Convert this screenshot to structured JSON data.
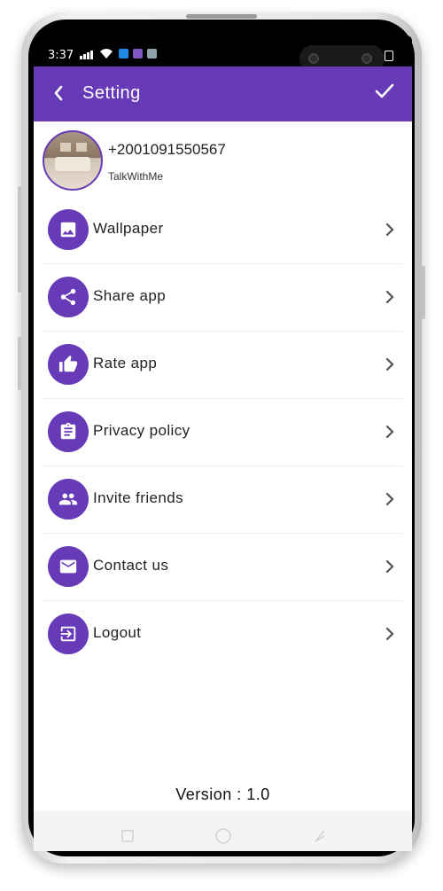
{
  "status_bar": {
    "time": "3:37"
  },
  "app_bar": {
    "title": "Setting",
    "back_icon": "back-arrow-icon",
    "confirm_icon": "check-icon"
  },
  "profile": {
    "phone": "+2001091550567",
    "app_name": "TalkWithMe"
  },
  "menu": {
    "items": [
      {
        "label": "Wallpaper",
        "icon": "image-icon"
      },
      {
        "label": "Share app",
        "icon": "share-icon"
      },
      {
        "label": "Rate app",
        "icon": "thumbs-up-icon"
      },
      {
        "label": "Privacy policy",
        "icon": "clipboard-icon"
      },
      {
        "label": "Invite friends",
        "icon": "people-icon"
      },
      {
        "label": "Contact us",
        "icon": "mail-icon"
      },
      {
        "label": "Logout",
        "icon": "exit-icon"
      }
    ]
  },
  "footer": {
    "version": "Version : 1.0"
  },
  "colors": {
    "primary": "#673ab7",
    "background": "#ffffff",
    "text": "#222222"
  }
}
